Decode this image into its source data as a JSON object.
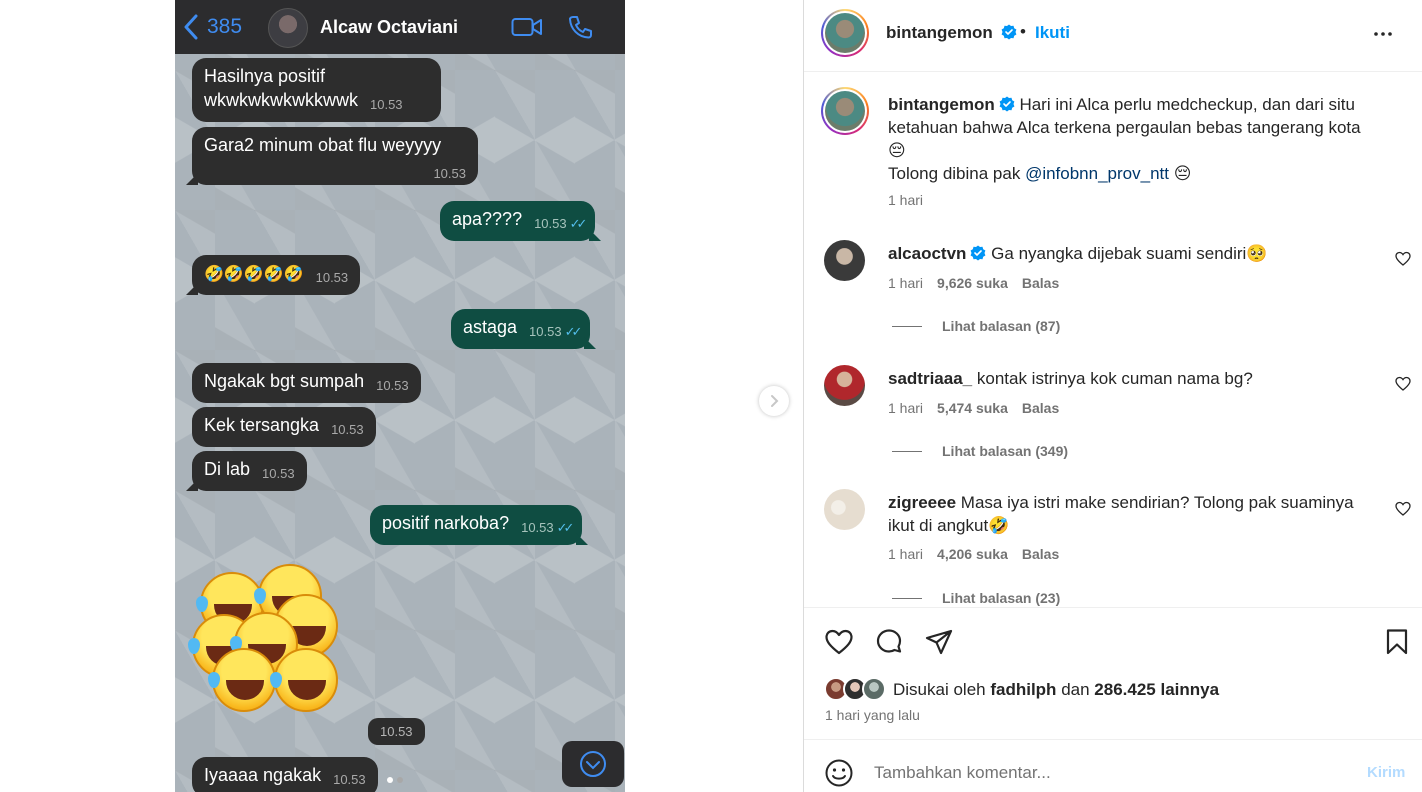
{
  "chat": {
    "back_count": "385",
    "contact_name": "Alcaw Octaviani",
    "messages": [
      {
        "dir": "in",
        "lines": [
          "Hasilnya positif",
          "wkwkwkwkwkkwwk"
        ],
        "time": "10.53"
      },
      {
        "dir": "in",
        "lines": [
          "Gara2 minum obat flu weyyyy"
        ],
        "time": "10.53"
      },
      {
        "dir": "out",
        "text": "apa????",
        "time": "10.53"
      },
      {
        "dir": "in",
        "text": "🤣🤣🤣🤣🤣",
        "time": "10.53"
      },
      {
        "dir": "out",
        "text": "astaga",
        "time": "10.53"
      },
      {
        "dir": "in",
        "text": "Ngakak bgt sumpah",
        "time": "10.53"
      },
      {
        "dir": "in",
        "text": "Kek tersangka",
        "time": "10.53"
      },
      {
        "dir": "in",
        "text": "Di lab",
        "time": "10.53"
      },
      {
        "dir": "out",
        "text": "positif narkoba?",
        "time": "10.53"
      },
      {
        "dir": "in",
        "text": "Iyaaaa ngakak",
        "time": "10.53"
      }
    ],
    "sticker_time": "10.53"
  },
  "post": {
    "username": "bintangemon",
    "separator": "•",
    "follow_label": "Ikuti",
    "caption": {
      "username": "bintangemon",
      "text": "Hari ini Alca perlu medcheckup, dan dari situ ketahuan bahwa Alca terkena pergaulan bebas tangerang kota",
      "emoji1": "😔",
      "line2_prefix": "Tolong dibina pak",
      "mention": "@infobnn_prov_ntt",
      "emoji2": "😔",
      "time": "1 hari"
    },
    "comments": [
      {
        "user": "alcaoctvn",
        "verified": true,
        "text": "Ga nyangka dijebak suami sendiri🥺",
        "time": "1 hari",
        "likes": "9,626 suka",
        "reply": "Balas",
        "replies": "Lihat balasan (87)"
      },
      {
        "user": "sadtriaaa_",
        "verified": false,
        "text": "kontak istrinya kok cuman nama bg?",
        "time": "1 hari",
        "likes": "5,474 suka",
        "reply": "Balas",
        "replies": "Lihat balasan (349)"
      },
      {
        "user": "zigreeee",
        "verified": false,
        "text": "Masa iya istri make sendirian? Tolong pak suaminya ikut di angkut🤣",
        "time": "1 hari",
        "likes": "4,206 suka",
        "reply": "Balas",
        "replies": "Lihat balasan (23)"
      }
    ],
    "liked_by_prefix": "Disukai oleh",
    "liked_by_user": "fadhilph",
    "liked_by_mid": "dan",
    "liked_by_count": "286.425 lainnya",
    "post_time": "1 hari yang lalu",
    "comment_placeholder": "Tambahkan komentar...",
    "post_button": "Kirim"
  },
  "colors": {
    "accent": "#0095f6",
    "out_bubble": "#0f4d42",
    "in_bubble": "#2d2d2d"
  }
}
